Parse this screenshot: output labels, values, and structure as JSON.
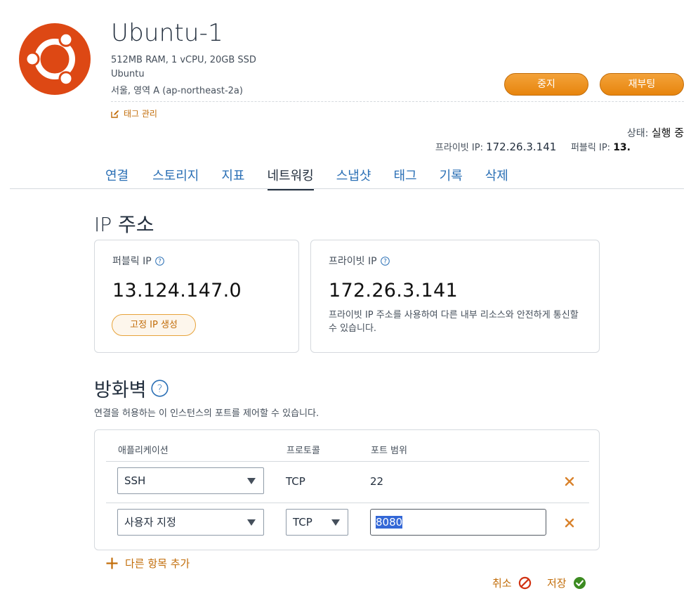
{
  "instance": {
    "name": "Ubuntu-1",
    "specs": "512MB RAM, 1 vCPU, 20GB SSD",
    "os": "Ubuntu",
    "region": "서울, 영역 A (ap-northeast-2a)",
    "tag_manage": "태그 관리",
    "status_label": "상태:",
    "status_value": "실행 중",
    "private_ip_label": "프라이빗 IP:",
    "private_ip_value": "172.26.3.141",
    "public_ip_label": "퍼블릭 IP:",
    "public_ip_value": "13."
  },
  "actions": {
    "stop": "중지",
    "reboot": "재부팅"
  },
  "tabs": [
    {
      "label": "연결"
    },
    {
      "label": "스토리지"
    },
    {
      "label": "지표"
    },
    {
      "label": "네트워킹",
      "active": true
    },
    {
      "label": "스냅샷"
    },
    {
      "label": "태그"
    },
    {
      "label": "기록"
    },
    {
      "label": "삭제"
    }
  ],
  "ip_section": {
    "heading": "IP 주소",
    "public": {
      "label": "퍼블릭 IP",
      "value": "13.124.147.0",
      "button": "고정 IP 생성"
    },
    "private": {
      "label": "프라이빗 IP",
      "value": "172.26.3.141",
      "description": "프라이빗 IP 주소를 사용하여 다른 내부 리소스와 안전하게 통신할 수 있습니다."
    }
  },
  "firewall": {
    "heading": "방화벽",
    "description": "연결을 허용하는 이 인스턴스의 포트를 제어할 수 있습니다.",
    "columns": {
      "application": "애플리케이션",
      "protocol": "프로토콜",
      "port_range": "포트 범위"
    },
    "rules": [
      {
        "application": "SSH",
        "protocol": "TCP",
        "port": "22"
      },
      {
        "application": "사용자 지정",
        "protocol": "TCP",
        "port": "8080"
      }
    ],
    "add_more": "다른 항목 추가",
    "cancel": "취소",
    "save": "저장"
  },
  "colors": {
    "accent": "#e7850d",
    "link": "#2a6fb5",
    "ubuntu": "#dd4814",
    "save_green": "#3c8b21"
  },
  "icons": [
    "ubuntu-logo-icon",
    "edit-icon",
    "help-icon",
    "chevron-down-icon",
    "close-icon",
    "plus-icon",
    "cancel-icon",
    "check-icon"
  ]
}
